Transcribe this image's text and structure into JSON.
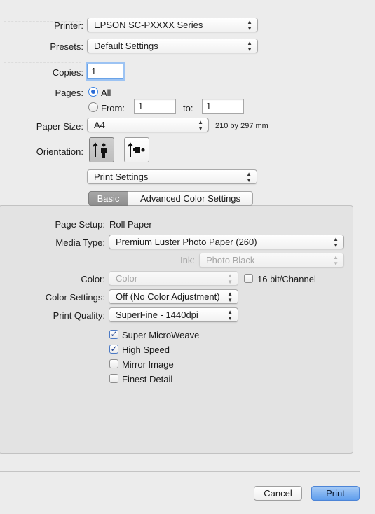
{
  "printer": {
    "label": "Printer:",
    "value": "EPSON SC-PXXXX Series"
  },
  "presets": {
    "label": "Presets:",
    "value": "Default Settings"
  },
  "copies": {
    "label": "Copies:",
    "value": "1"
  },
  "pages": {
    "label": "Pages:",
    "all_label": "All",
    "from_label": "From:",
    "from_value": "1",
    "to_label": "to:",
    "to_value": "1",
    "selected": "All"
  },
  "paper_size": {
    "label": "Paper Size:",
    "value": "A4",
    "dimensions": "210 by 297 mm"
  },
  "orientation": {
    "label": "Orientation:",
    "selected": "portrait"
  },
  "section_popup": {
    "value": "Print Settings"
  },
  "tabs": [
    {
      "label": "Basic",
      "selected": true
    },
    {
      "label": "Advanced Color Settings",
      "selected": false
    }
  ],
  "settings": {
    "page_setup": {
      "label": "Page Setup:",
      "value": "Roll Paper"
    },
    "media_type": {
      "label": "Media Type:",
      "value": "Premium Luster Photo Paper (260)"
    },
    "ink": {
      "label": "Ink:",
      "value": "Photo Black"
    },
    "color": {
      "label": "Color:",
      "value": "Color"
    },
    "bit_channel": {
      "label": "16 bit/Channel",
      "checked": false
    },
    "color_settings": {
      "label": "Color Settings:",
      "value": "Off (No Color Adjustment)"
    },
    "print_quality": {
      "label": "Print Quality:",
      "value": "SuperFine - 1440dpi"
    },
    "checkboxes": [
      {
        "label": "Super MicroWeave",
        "checked": true
      },
      {
        "label": "High Speed",
        "checked": true
      },
      {
        "label": "Mirror Image",
        "checked": false
      },
      {
        "label": "Finest Detail",
        "checked": false
      }
    ]
  },
  "buttons": {
    "cancel": "Cancel",
    "print": "Print"
  },
  "colors": {
    "accent": "#5e9ded",
    "window_bg": "#ececec",
    "panel_bg": "#e3e3e3"
  }
}
